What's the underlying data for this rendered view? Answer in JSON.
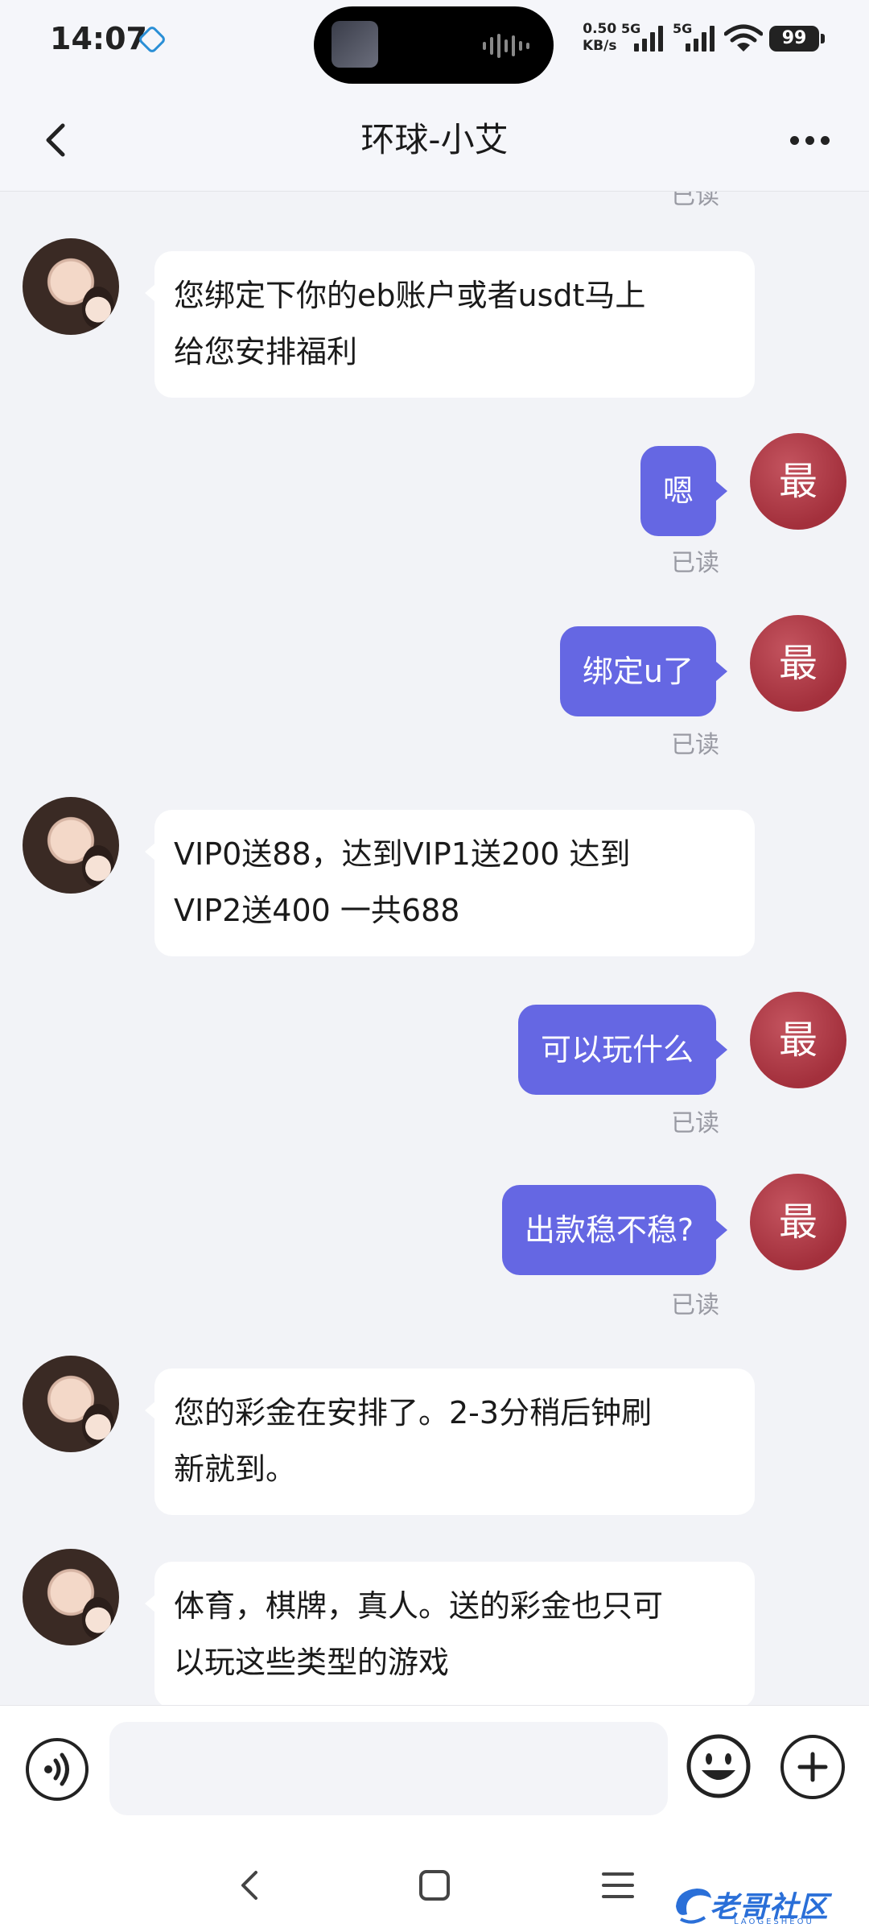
{
  "status_bar": {
    "time": "14:07",
    "net_speed_value": "0.50",
    "net_speed_unit": "KB/s",
    "signal1_label": "5G",
    "signal2_label": "5G",
    "battery": "99"
  },
  "header": {
    "title": "环球-小艾"
  },
  "messages": [
    {
      "sender": "other",
      "text_line1": "您绑定下你的eb账户或者usdt马上",
      "text_line2": "给您安排福利"
    },
    {
      "sender": "me",
      "avatar_label": "最",
      "text": "嗯",
      "status": "已读"
    },
    {
      "sender": "me",
      "avatar_label": "最",
      "text": "绑定u了",
      "status": "已读"
    },
    {
      "sender": "other",
      "text_line1": "VIP0送88，达到VIP1送200 达到",
      "text_line2": "VIP2送400 一共688"
    },
    {
      "sender": "me",
      "avatar_label": "最",
      "text": "可以玩什么",
      "status": "已读"
    },
    {
      "sender": "me",
      "avatar_label": "最",
      "text": "出款稳不稳?",
      "status": "已读"
    },
    {
      "sender": "other",
      "text_line1": "您的彩金在安排了。2-3分稍后钟刷",
      "text_line2": "新就到。"
    },
    {
      "sender": "other",
      "text_line1": "体育，棋牌，真人。送的彩金也只可",
      "text_line2": "以玩这些类型的游戏"
    }
  ],
  "top_partial_status": "已读",
  "input": {
    "placeholder": ""
  },
  "watermark": {
    "text": "老哥社区",
    "sub": "LAOGESHEOU"
  },
  "colors": {
    "my_bubble": "#6567e3",
    "my_avatar": "#a3303c",
    "background": "#f2f3f7"
  }
}
